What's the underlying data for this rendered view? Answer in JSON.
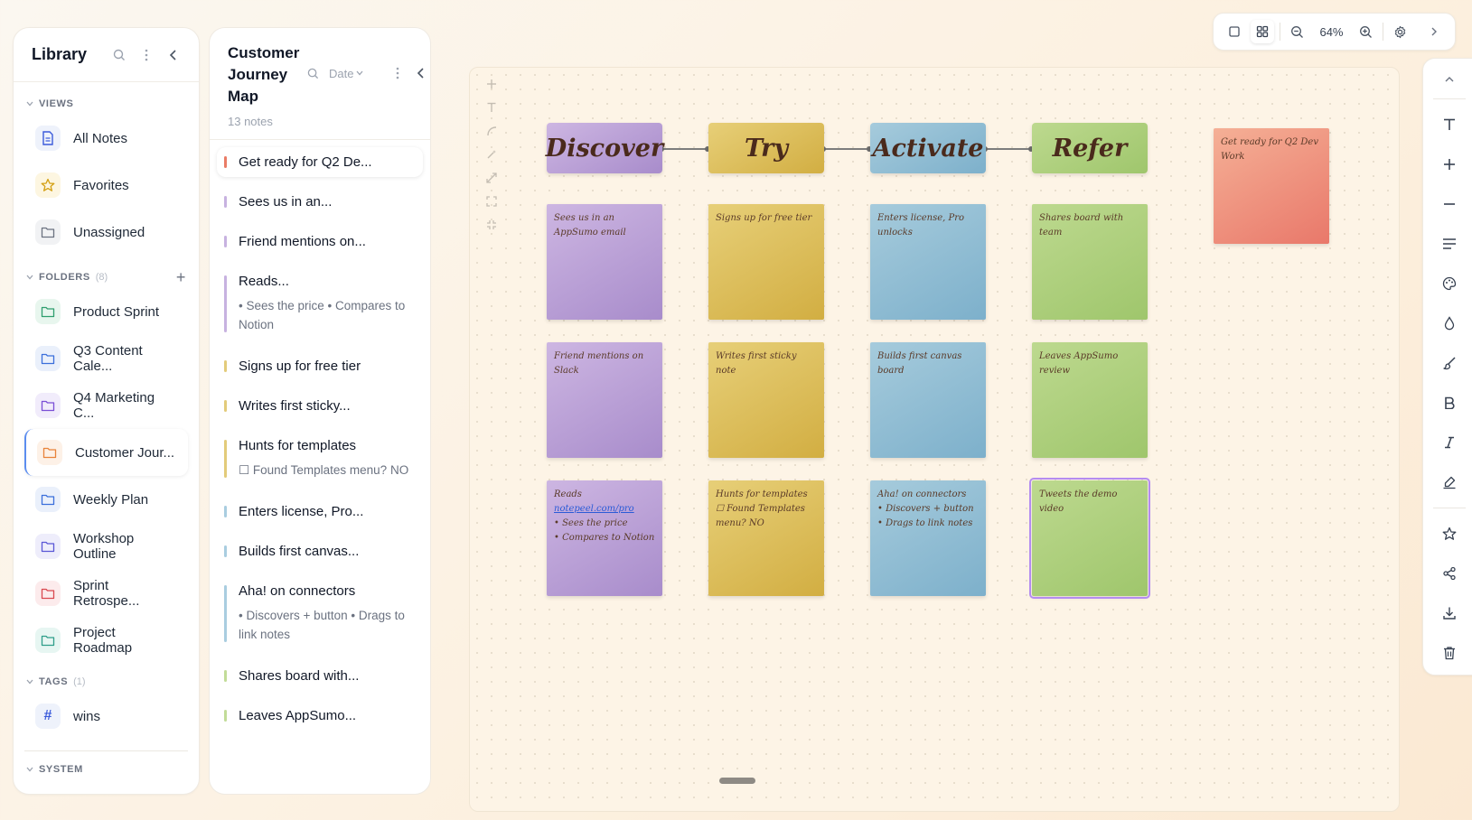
{
  "library": {
    "title": "Library",
    "views_label": "VIEWS",
    "views": [
      {
        "label": "All Notes",
        "icon": "document-icon",
        "color": "#3b5bdb",
        "bg": "#eef2fb"
      },
      {
        "label": "Favorites",
        "icon": "star-icon",
        "color": "#d4a014",
        "bg": "#fdf6e1"
      },
      {
        "label": "Unassigned",
        "icon": "folder-icon",
        "color": "#6b7280",
        "bg": "#f1f2f4"
      }
    ],
    "folders_label": "FOLDERS",
    "folders_count": "(8)",
    "folders": [
      {
        "label": "Product Sprint",
        "color": "#2f9e6e",
        "bg": "#e8f6ee"
      },
      {
        "label": "Q3 Content Cale...",
        "color": "#3b6fdb",
        "bg": "#eaf0fb"
      },
      {
        "label": "Q4 Marketing C...",
        "color": "#7b4fd6",
        "bg": "#f1ecfb"
      },
      {
        "label": "Customer Jour...",
        "color": "#e8833a",
        "bg": "#fdf1e7",
        "active": true
      },
      {
        "label": "Weekly Plan",
        "color": "#3b6fdb",
        "bg": "#eaf0fb"
      },
      {
        "label": "Workshop Outline",
        "color": "#5a57d6",
        "bg": "#eeedfb"
      },
      {
        "label": "Sprint Retrospe...",
        "color": "#d9484f",
        "bg": "#fcebec"
      },
      {
        "label": "Project Roadmap",
        "color": "#2f9e8a",
        "bg": "#e7f6f2"
      }
    ],
    "tags_label": "TAGS",
    "tags_count": "(1)",
    "tags": [
      {
        "label": "wins",
        "symbol": "#",
        "color": "#3b5bdb",
        "bg": "#eef2fb"
      }
    ],
    "system_label": "SYSTEM"
  },
  "notes_panel": {
    "title": "Customer Journey Map",
    "count": "13 notes",
    "sort_label": "Date",
    "items": [
      {
        "title": "Get ready for Q2 De...",
        "color": "#ea7c66",
        "selected": true
      },
      {
        "title": "Sees us in an...",
        "color": "#c7b2e0"
      },
      {
        "title": "Friend mentions on...",
        "color": "#c7b2e0"
      },
      {
        "title": "Reads...",
        "sub": "• Sees the price • Compares to Notion",
        "color": "#c7b2e0"
      },
      {
        "title": "Signs up for free tier",
        "color": "#e3cb7a"
      },
      {
        "title": "Writes first sticky...",
        "color": "#e3cb7a"
      },
      {
        "title": "Hunts for templates",
        "sub": "☐ Found Templates menu? NO",
        "color": "#e3cb7a"
      },
      {
        "title": "Enters license, Pro...",
        "color": "#a9cde0"
      },
      {
        "title": "Builds first canvas...",
        "color": "#a9cde0"
      },
      {
        "title": "Aha! on connectors",
        "sub": "• Discovers + button • Drags to link notes",
        "color": "#a9cde0"
      },
      {
        "title": "Shares board with...",
        "color": "#c2dc98"
      },
      {
        "title": "Leaves AppSumo...",
        "color": "#c2dc98"
      }
    ]
  },
  "canvas": {
    "headers": [
      {
        "label": "Discover",
        "color": "purple"
      },
      {
        "label": "Try",
        "color": "yellow"
      },
      {
        "label": "Activate",
        "color": "blue"
      },
      {
        "label": "Refer",
        "color": "green"
      }
    ],
    "stickies": {
      "discover": [
        "Sees us in an AppSumo email",
        "Friend mentions on Slack"
      ],
      "try": [
        "Signs up for free tier",
        "Writes first sticky note"
      ],
      "activate": [
        "Enters license, Pro unlocks",
        "Builds first canvas board"
      ],
      "refer": [
        "Shares board with team",
        "Leaves AppSumo review",
        "Tweets the demo video"
      ],
      "reads_prefix": "Reads ",
      "reads_link": "notepeel.com/pro",
      "reads_lines": [
        "• Sees the price",
        "• Compares to Notion"
      ],
      "hunts_lines": [
        "Hunts for templates",
        "☐ Found Templates",
        "menu? NO"
      ],
      "aha_lines": [
        "Aha! on connectors",
        "• Discovers + button",
        "• Drags to link notes"
      ],
      "standalone": "Get ready for Q2 Dev Work"
    }
  },
  "toolbar": {
    "zoom": "64%"
  }
}
